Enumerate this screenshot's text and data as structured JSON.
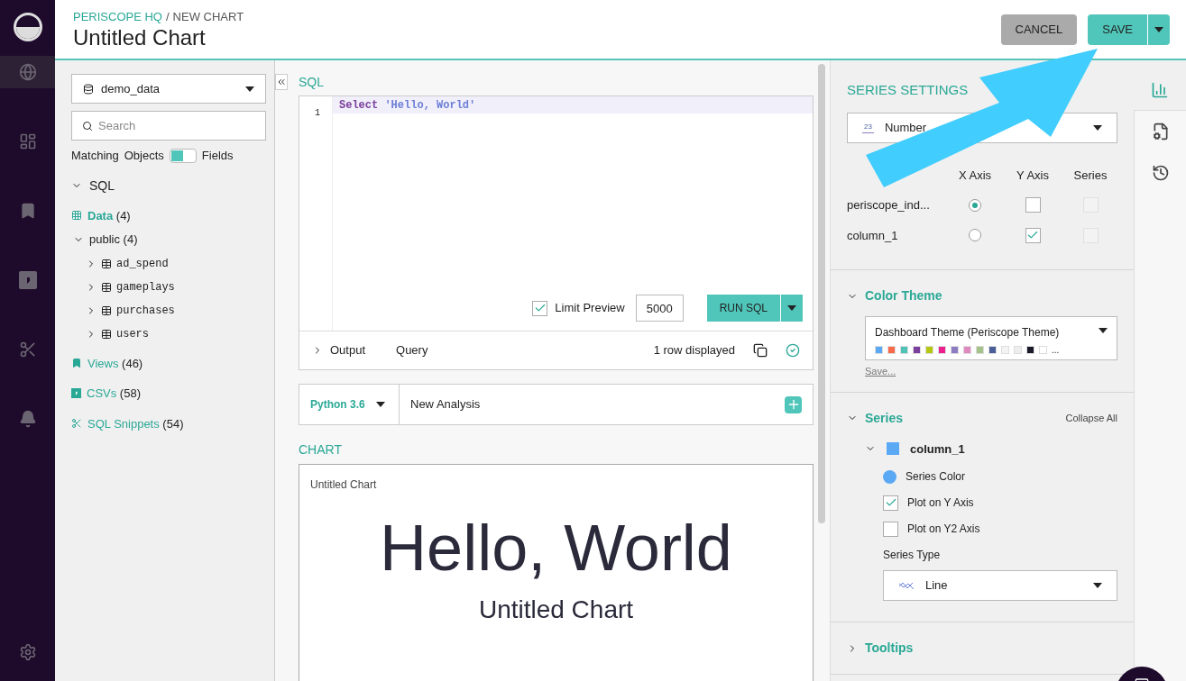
{
  "header": {
    "breadcrumb_org": "PERISCOPE HQ",
    "breadcrumb_sep": "/",
    "breadcrumb_page": "NEW CHART",
    "title": "Untitled Chart",
    "cancel": "CANCEL",
    "save": "SAVE"
  },
  "nav": {
    "items": [
      {
        "kind": "globe",
        "selected": true
      },
      {
        "kind": "dashboard",
        "selected": false
      },
      {
        "kind": "bookmark",
        "selected": false
      },
      {
        "kind": "csv",
        "selected": false
      },
      {
        "kind": "snippet",
        "selected": false
      },
      {
        "kind": "bell",
        "selected": false
      }
    ]
  },
  "schema": {
    "database": "demo_data",
    "search_placeholder": "Search",
    "matching": "Matching",
    "objects": "Objects",
    "fields": "Fields",
    "fields_on": false,
    "sql": "SQL",
    "data": {
      "label": "Data",
      "count": "(4)"
    },
    "schema_name": "public",
    "schema_count": "(4)",
    "tables": [
      "ad_spend",
      "gameplays",
      "purchases",
      "users"
    ],
    "groups": [
      {
        "kind": "views",
        "label": "Views",
        "count": "(46)"
      },
      {
        "kind": "csv",
        "label": "CSVs",
        "count": "(58)"
      },
      {
        "kind": "snippet",
        "label": "SQL Snippets",
        "count": "(54)"
      }
    ]
  },
  "editor": {
    "heading": "SQL",
    "line_number": "1",
    "keyword": "Select",
    "string": "'Hello, World'",
    "limit_label": "Limit Preview",
    "limit_checked": true,
    "limit_value": "5000",
    "run": "RUN SQL",
    "output": "Output",
    "query": "Query",
    "rows": "1 row displayed"
  },
  "python": {
    "version": "Python 3.6",
    "name": "New Analysis"
  },
  "chart": {
    "heading": "CHART",
    "small_title": "Untitled Chart",
    "value": "Hello, World",
    "subtitle": "Untitled Chart"
  },
  "settings": {
    "heading": "SERIES SETTINGS",
    "type_icon": "23",
    "type": "Number",
    "columns": [
      "X Axis",
      "Y Axis",
      "Series"
    ],
    "rows": [
      {
        "name": "periscope_ind...",
        "x_selected": true,
        "y_checked": false,
        "series_disabled": true
      },
      {
        "name": "column_1",
        "x_selected": false,
        "y_checked": true,
        "series_disabled": true
      }
    ],
    "color_theme": {
      "heading": "Color Theme",
      "expanded": true,
      "name": "Dashboard Theme (Periscope Theme)",
      "more": "...",
      "save": "Save...",
      "swatches": [
        {
          "color": "#5ba8f5"
        },
        {
          "color": "#f96a4b"
        },
        {
          "color": "#4fc3b7"
        },
        {
          "color": "#7b3f9e"
        },
        {
          "color": "#b5c80f"
        },
        {
          "color": "#ee1f8e"
        },
        {
          "color": "#8e7cc3"
        },
        {
          "color": "#e08bc0"
        },
        {
          "color": "#a4c28a"
        },
        {
          "color": "#4a5f9a"
        },
        {
          "color": "#f3f3f3"
        },
        {
          "color": "#eeeeee"
        },
        {
          "color": "#1a1a2a"
        },
        {
          "color": "#ffffff"
        }
      ]
    },
    "series": {
      "heading": "Series",
      "expanded": true,
      "collapse_all": "Collapse All",
      "name": "column_1",
      "color": "#5ba8f5",
      "color_label": "Series Color",
      "options": [
        {
          "label": "Plot on Y Axis",
          "checked": true
        },
        {
          "label": "Plot on Y2 Axis",
          "checked": false
        }
      ],
      "type_label": "Series Type",
      "type": "Line"
    },
    "tooltips": {
      "heading": "Tooltips",
      "expanded": false
    }
  },
  "side_tabs": [
    {
      "kind": "chart",
      "selected": true
    },
    {
      "kind": "doc",
      "selected": false
    },
    {
      "kind": "history",
      "selected": false
    }
  ]
}
